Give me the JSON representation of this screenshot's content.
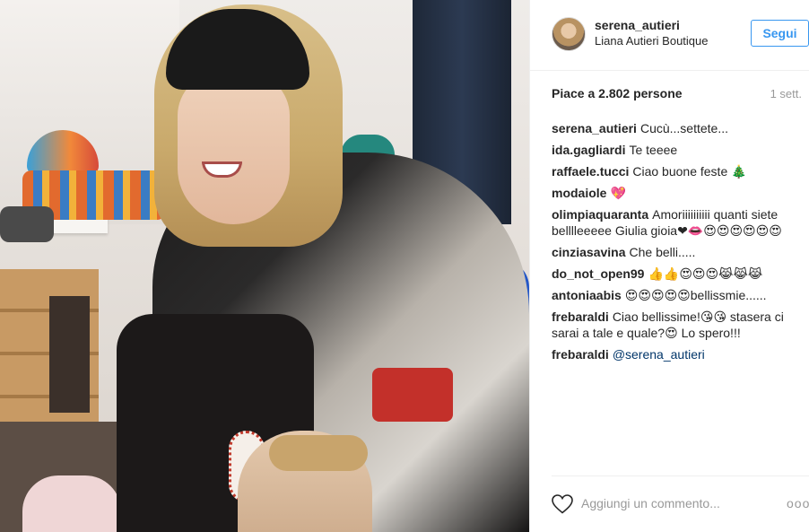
{
  "post": {
    "author": "serena_autieri",
    "location": "Liana Autieri Boutique",
    "follow_label": "Segui",
    "likes": "Piace a 2.802 persone",
    "time": "1 sett.",
    "add_comment_placeholder": "Aggiungi un commento...",
    "more_label": "ooo"
  },
  "comments": [
    {
      "user": "serena_autieri",
      "text": "Cucù...settete..."
    },
    {
      "user": "ida.gagliardi",
      "text": "Te teeee"
    },
    {
      "user": "raffaele.tucci",
      "text": "Ciao buone feste 🎄"
    },
    {
      "user": "modaiole",
      "text": "💖"
    },
    {
      "user": "olimpiaquaranta",
      "text": "Amoriiiiiiiiii quanti siete belllleeeee Giulia gioia❤👄😍😍😍😍😍😍"
    },
    {
      "user": "cinziasavina",
      "text": "Che belli....."
    },
    {
      "user": "do_not_open99",
      "text": "👍👍😍😍😍😹😹😹"
    },
    {
      "user": "antoniaabis",
      "text": "😍😍😍😍😍bellissmie......"
    },
    {
      "user": "frebaraldi",
      "text": "Ciao bellissime!😘😘 stasera ci sarai a tale e quale?😍 Lo spero!!!"
    },
    {
      "user": "frebaraldi",
      "text": "@serena_autieri"
    }
  ],
  "icons": {
    "avatar": "profile-avatar",
    "heart": "heart-icon",
    "more": "more-options-icon"
  },
  "colors": {
    "accent": "#3897f0",
    "text": "#262626",
    "muted": "#999999",
    "border": "#efefef"
  }
}
